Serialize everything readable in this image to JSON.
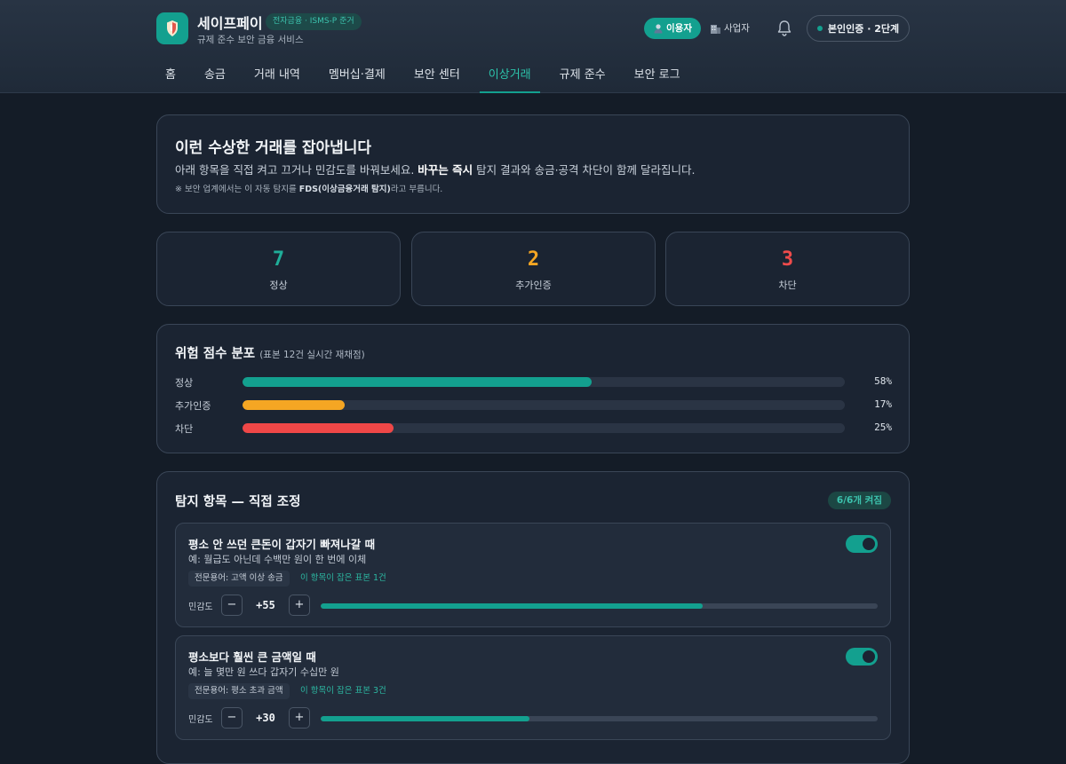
{
  "header": {
    "app_title": "세이프페이",
    "compliance_badge": "전자금융 · ISMS-P 준거",
    "subtitle": "규제 준수 보안 금융 서비스",
    "roles": [
      {
        "label": "이용자",
        "icon": "user-icon",
        "active": true
      },
      {
        "label": "사업자",
        "icon": "building-icon",
        "active": false
      }
    ],
    "verify_label": "본인인증 · 2단계"
  },
  "nav": {
    "tabs": [
      {
        "label": "홈",
        "active": false
      },
      {
        "label": "송금",
        "active": false
      },
      {
        "label": "거래 내역",
        "active": false
      },
      {
        "label": "멤버십·결제",
        "active": false
      },
      {
        "label": "보안 센터",
        "active": false
      },
      {
        "label": "이상거래",
        "active": true
      },
      {
        "label": "규제 준수",
        "active": false
      },
      {
        "label": "보안 로그",
        "active": false
      }
    ]
  },
  "hero": {
    "title": "이런 수상한 거래를 잡아냅니다",
    "desc_before": "아래 항목을 직접 켜고 끄거나 민감도를 바꿔보세요. ",
    "desc_bold": "바꾸는 즉시",
    "desc_after": " 탐지 결과와 송금·공격 차단이 함께 달라집니다.",
    "note_before": "※ 보안 업계에서는 이 자동 탐지를 ",
    "note_bold": "FDS(이상금융거래 탐지)",
    "note_after": "라고 부릅니다."
  },
  "stats": [
    {
      "value": "7",
      "label": "정상",
      "color": "#1fae99"
    },
    {
      "value": "2",
      "label": "추가인증",
      "color": "#f5a623"
    },
    {
      "value": "3",
      "label": "차단",
      "color": "#ef4b4b"
    }
  ],
  "distribution": {
    "title": "위험 점수 분포",
    "subtitle": "(표본 12건 실시간 재채점)",
    "rows": [
      {
        "label": "정상",
        "percent": 58,
        "percent_label": "58%",
        "color": "#13a08f"
      },
      {
        "label": "추가인증",
        "percent": 17,
        "percent_label": "17%",
        "color": "#f5a623"
      },
      {
        "label": "차단",
        "percent": 25,
        "percent_label": "25%",
        "color": "#ef4747"
      }
    ]
  },
  "rules": {
    "title": "탐지 항목 — 직접 조정",
    "count_label": "6/6개 켜짐",
    "sensitivity_label": "민감도",
    "items": [
      {
        "title": "평소 안 쓰던 큰돈이 갑자기 빠져나갈 때",
        "example": "예: 월급도 아닌데 수백만 원이 한 번에 이체",
        "term": "전문용어: 고액 이상 송금",
        "hits": "이 항목이 잡은 표본 1건",
        "enabled": true,
        "value_label": "+55",
        "level": 0.686
      },
      {
        "title": "평소보다 훨씬 큰 금액일 때",
        "example": "예: 늘 몇만 원 쓰다 갑자기 수십만 원",
        "term": "전문용어: 평소 초과 금액",
        "hits": "이 항목이 잡은 표본 3건",
        "enabled": true,
        "value_label": "+30",
        "level": 0.375
      }
    ]
  }
}
